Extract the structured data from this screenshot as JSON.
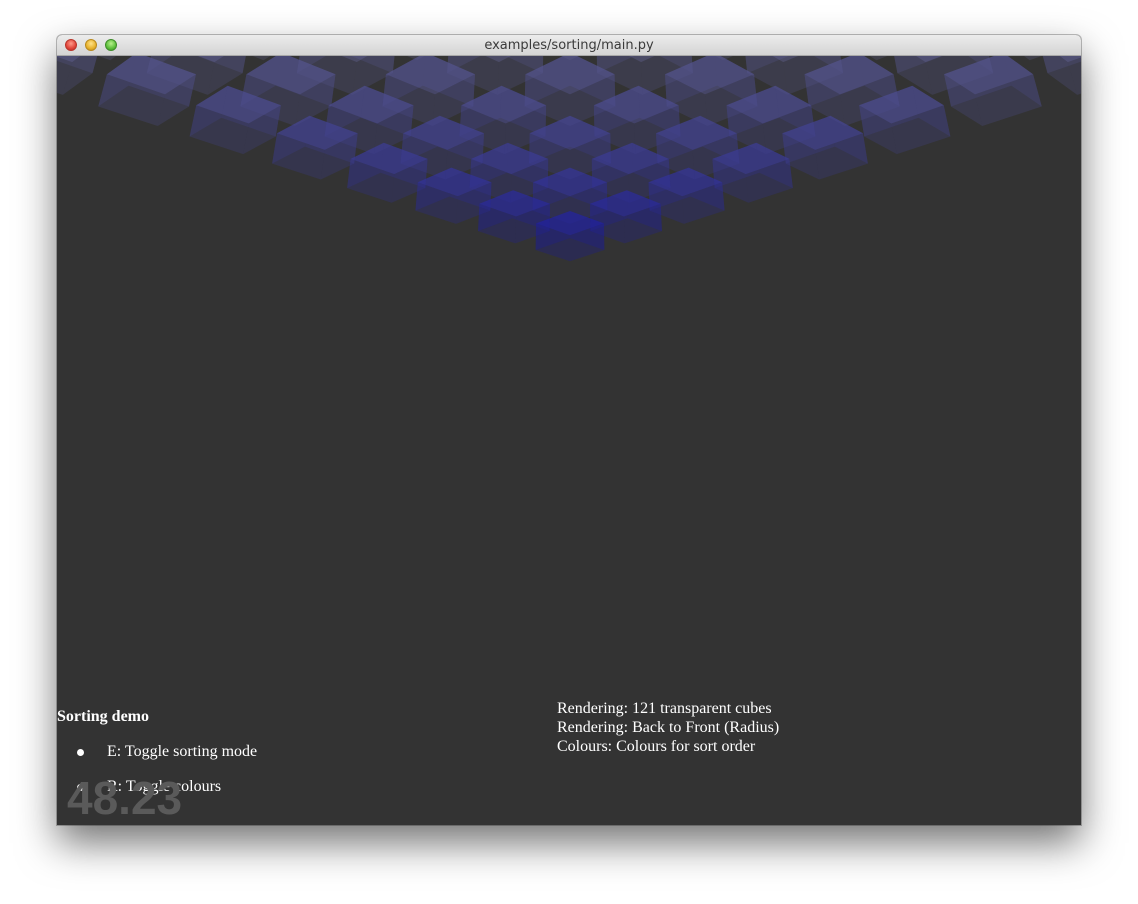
{
  "window": {
    "title": "examples/sorting/main.py"
  },
  "scene": {
    "grid_size": 11,
    "cube_count": 121,
    "near_color": "#ecec82",
    "far_color": "#2020c8",
    "background": "#333333"
  },
  "help": {
    "title": "Sorting demo",
    "items": [
      "E: Toggle sorting mode",
      "R: Toggle colours"
    ]
  },
  "fps": "48.23",
  "status": {
    "lines": [
      "Rendering: 121 transparent cubes",
      "Rendering: Back to Front (Radius)",
      "Colours: Colours for sort order"
    ]
  }
}
